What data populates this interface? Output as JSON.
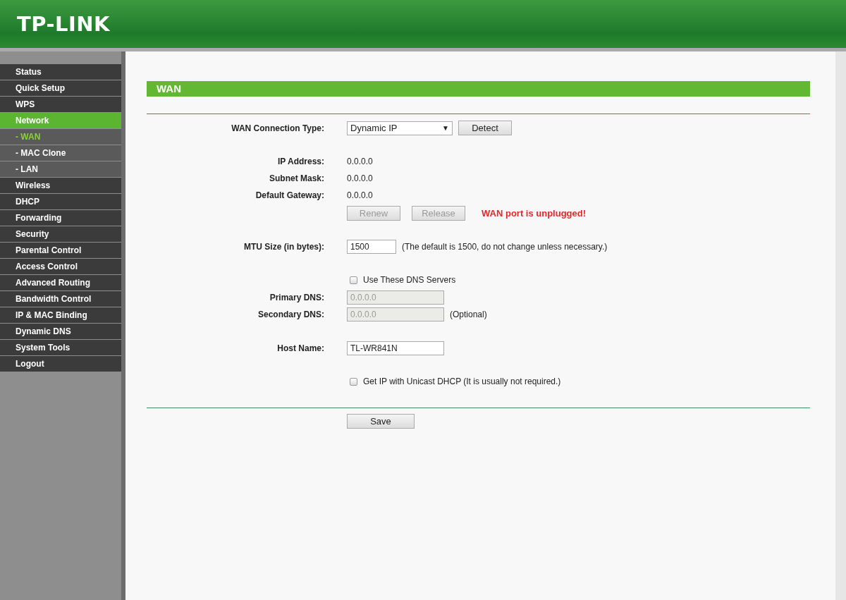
{
  "header": {
    "logo": "TP-LINK"
  },
  "menu": [
    {
      "label": "Status",
      "kind": "main",
      "expanded": false,
      "selected": false
    },
    {
      "label": "Quick Setup",
      "kind": "main",
      "expanded": false,
      "selected": false
    },
    {
      "label": "WPS",
      "kind": "main",
      "expanded": false,
      "selected": false
    },
    {
      "label": "Network",
      "kind": "main",
      "expanded": true,
      "selected": false
    },
    {
      "label": "- WAN",
      "kind": "sub",
      "expanded": false,
      "selected": true
    },
    {
      "label": "- MAC Clone",
      "kind": "sub",
      "expanded": false,
      "selected": false
    },
    {
      "label": "- LAN",
      "kind": "sub",
      "expanded": false,
      "selected": false
    },
    {
      "label": "Wireless",
      "kind": "main",
      "expanded": false,
      "selected": false
    },
    {
      "label": "DHCP",
      "kind": "main",
      "expanded": false,
      "selected": false
    },
    {
      "label": "Forwarding",
      "kind": "main",
      "expanded": false,
      "selected": false
    },
    {
      "label": "Security",
      "kind": "main",
      "expanded": false,
      "selected": false
    },
    {
      "label": "Parental Control",
      "kind": "main",
      "expanded": false,
      "selected": false
    },
    {
      "label": "Access Control",
      "kind": "main",
      "expanded": false,
      "selected": false
    },
    {
      "label": "Advanced Routing",
      "kind": "main",
      "expanded": false,
      "selected": false
    },
    {
      "label": "Bandwidth Control",
      "kind": "main",
      "expanded": false,
      "selected": false
    },
    {
      "label": "IP & MAC Binding",
      "kind": "main",
      "expanded": false,
      "selected": false
    },
    {
      "label": "Dynamic DNS",
      "kind": "main",
      "expanded": false,
      "selected": false
    },
    {
      "label": "System Tools",
      "kind": "main",
      "expanded": false,
      "selected": false
    },
    {
      "label": "Logout",
      "kind": "main",
      "expanded": false,
      "selected": false
    }
  ],
  "page": {
    "title": "WAN",
    "connection_type": {
      "label": "WAN Connection Type:",
      "value": "Dynamic IP",
      "arrow": "▼",
      "button": "Detect"
    },
    "info": [
      {
        "label": "IP Address:",
        "value": "0.0.0.0"
      },
      {
        "label": "Subnet Mask:",
        "value": "0.0.0.0"
      },
      {
        "label": "Default Gateway:",
        "value": "0.0.0.0"
      }
    ],
    "actions": {
      "buttons": [
        {
          "label": "Renew",
          "disabled": true
        },
        {
          "label": "Release",
          "disabled": true
        }
      ],
      "warning": "WAN port is unplugged!"
    },
    "mtu": {
      "label": "MTU Size (in bytes):",
      "value": "1500",
      "note": "(The default is 1500, do not change unless necessary.)"
    },
    "dns_toggle": {
      "label": "Use These DNS Servers",
      "checked": false
    },
    "dns": [
      {
        "label": "Primary DNS:",
        "value": "0.0.0.0",
        "disabled": true
      },
      {
        "label": "Secondary DNS:",
        "value": "0.0.0.0",
        "disabled": true,
        "note": "(Optional)"
      }
    ],
    "host": {
      "label": "Host Name:",
      "value": "TL-WR841N"
    },
    "unicast": {
      "label": "Get IP with Unicast DHCP (It is usually not required.)",
      "checked": false
    },
    "save": "Save"
  }
}
